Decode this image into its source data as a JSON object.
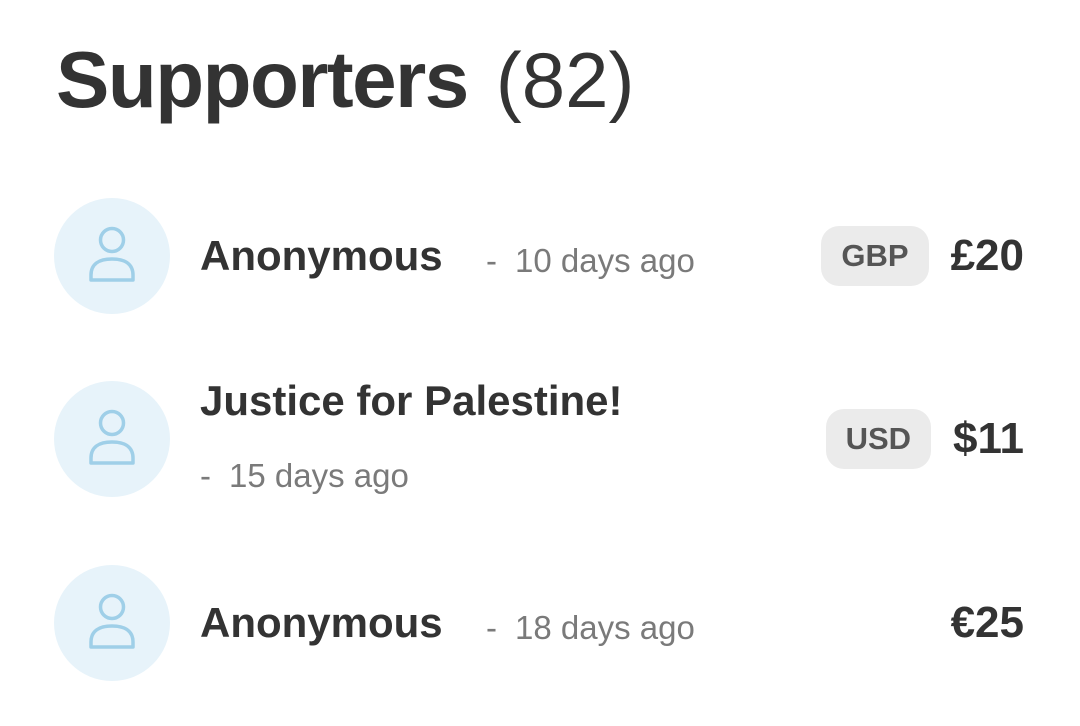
{
  "header": {
    "title": "Supporters",
    "count": "(82)"
  },
  "supporters": [
    {
      "name": "Anonymous",
      "separator": "-",
      "time": "10 days ago",
      "currency": "GBP",
      "amount": "£20"
    },
    {
      "name": "Justice for Palestine!",
      "separator": "-",
      "time": "15 days ago",
      "currency": "USD",
      "amount": "$11"
    },
    {
      "name": "Anonymous",
      "separator": "-",
      "time": "18 days ago",
      "currency": "",
      "amount": "€25"
    }
  ],
  "icons": {
    "avatar": "user-icon"
  },
  "colors": {
    "avatar_bg": "#e7f3fa",
    "avatar_icon": "#9fcfe8",
    "text": "#333333",
    "muted": "#7a7a7a",
    "badge_bg": "#ebebeb"
  }
}
